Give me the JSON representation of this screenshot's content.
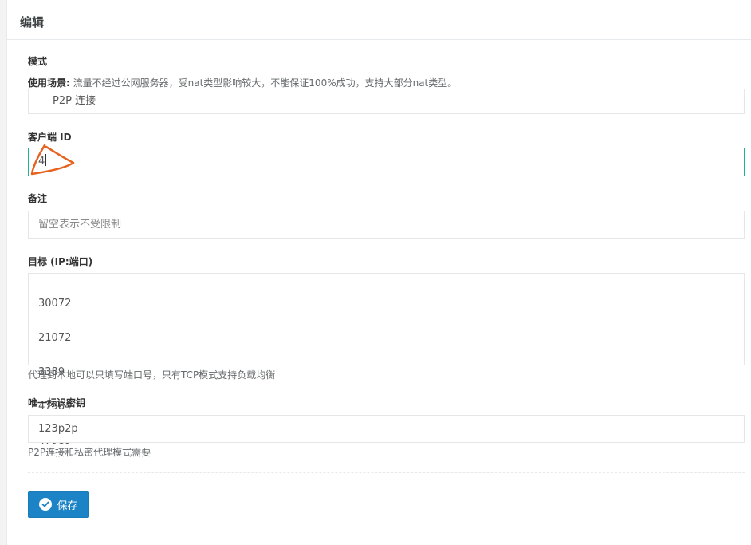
{
  "panel": {
    "title": "编辑"
  },
  "mode": {
    "label": "模式",
    "help_prefix": "使用场景:",
    "help_text": " 流量不经过公网服务器，受nat类型影响较大，不能保证100%成功，支持大部分nat类型。",
    "selected": "P2P 连接"
  },
  "client_id": {
    "label": "客户端 ID",
    "value": "4"
  },
  "remark": {
    "label": "备注",
    "placeholder": "留空表示不受限制"
  },
  "target": {
    "label": "目标 (IP:端口)",
    "lines": [
      "30072",
      "21072",
      "3389",
      "47984",
      "47989"
    ],
    "help": "代理到本地可以只填写端口号，只有TCP模式支持负载均衡"
  },
  "secret": {
    "label": "唯一标识密钥",
    "value": "123p2p",
    "help": "P2P连接和私密代理模式需要"
  },
  "actions": {
    "save_label": "保存"
  },
  "colors": {
    "primary": "#1c84c6",
    "focus": "#1ab394",
    "annotation": "#e8621f"
  }
}
